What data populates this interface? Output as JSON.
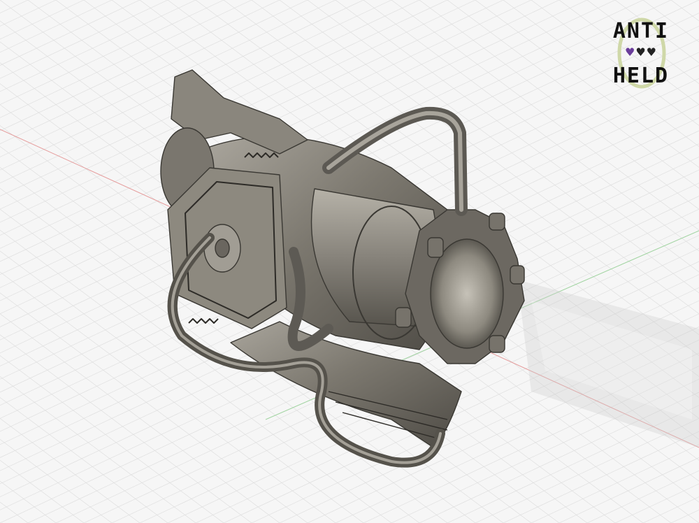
{
  "viewport": {
    "background_color": "#f6f6f6",
    "grid_color": "#dcdcdc",
    "axis_x_color": "#e59a9a",
    "axis_y_color": "#9fd39f",
    "model_color": "#7e7a72"
  },
  "logo": {
    "line1": "ANTI",
    "line2": "HELD",
    "hearts": [
      {
        "icon": "heart-icon",
        "color": "#6a3d9a"
      },
      {
        "icon": "heart-icon",
        "color": "#222222"
      },
      {
        "icon": "heart-icon",
        "color": "#222222"
      }
    ],
    "ring_color": "#cfd8a8"
  }
}
